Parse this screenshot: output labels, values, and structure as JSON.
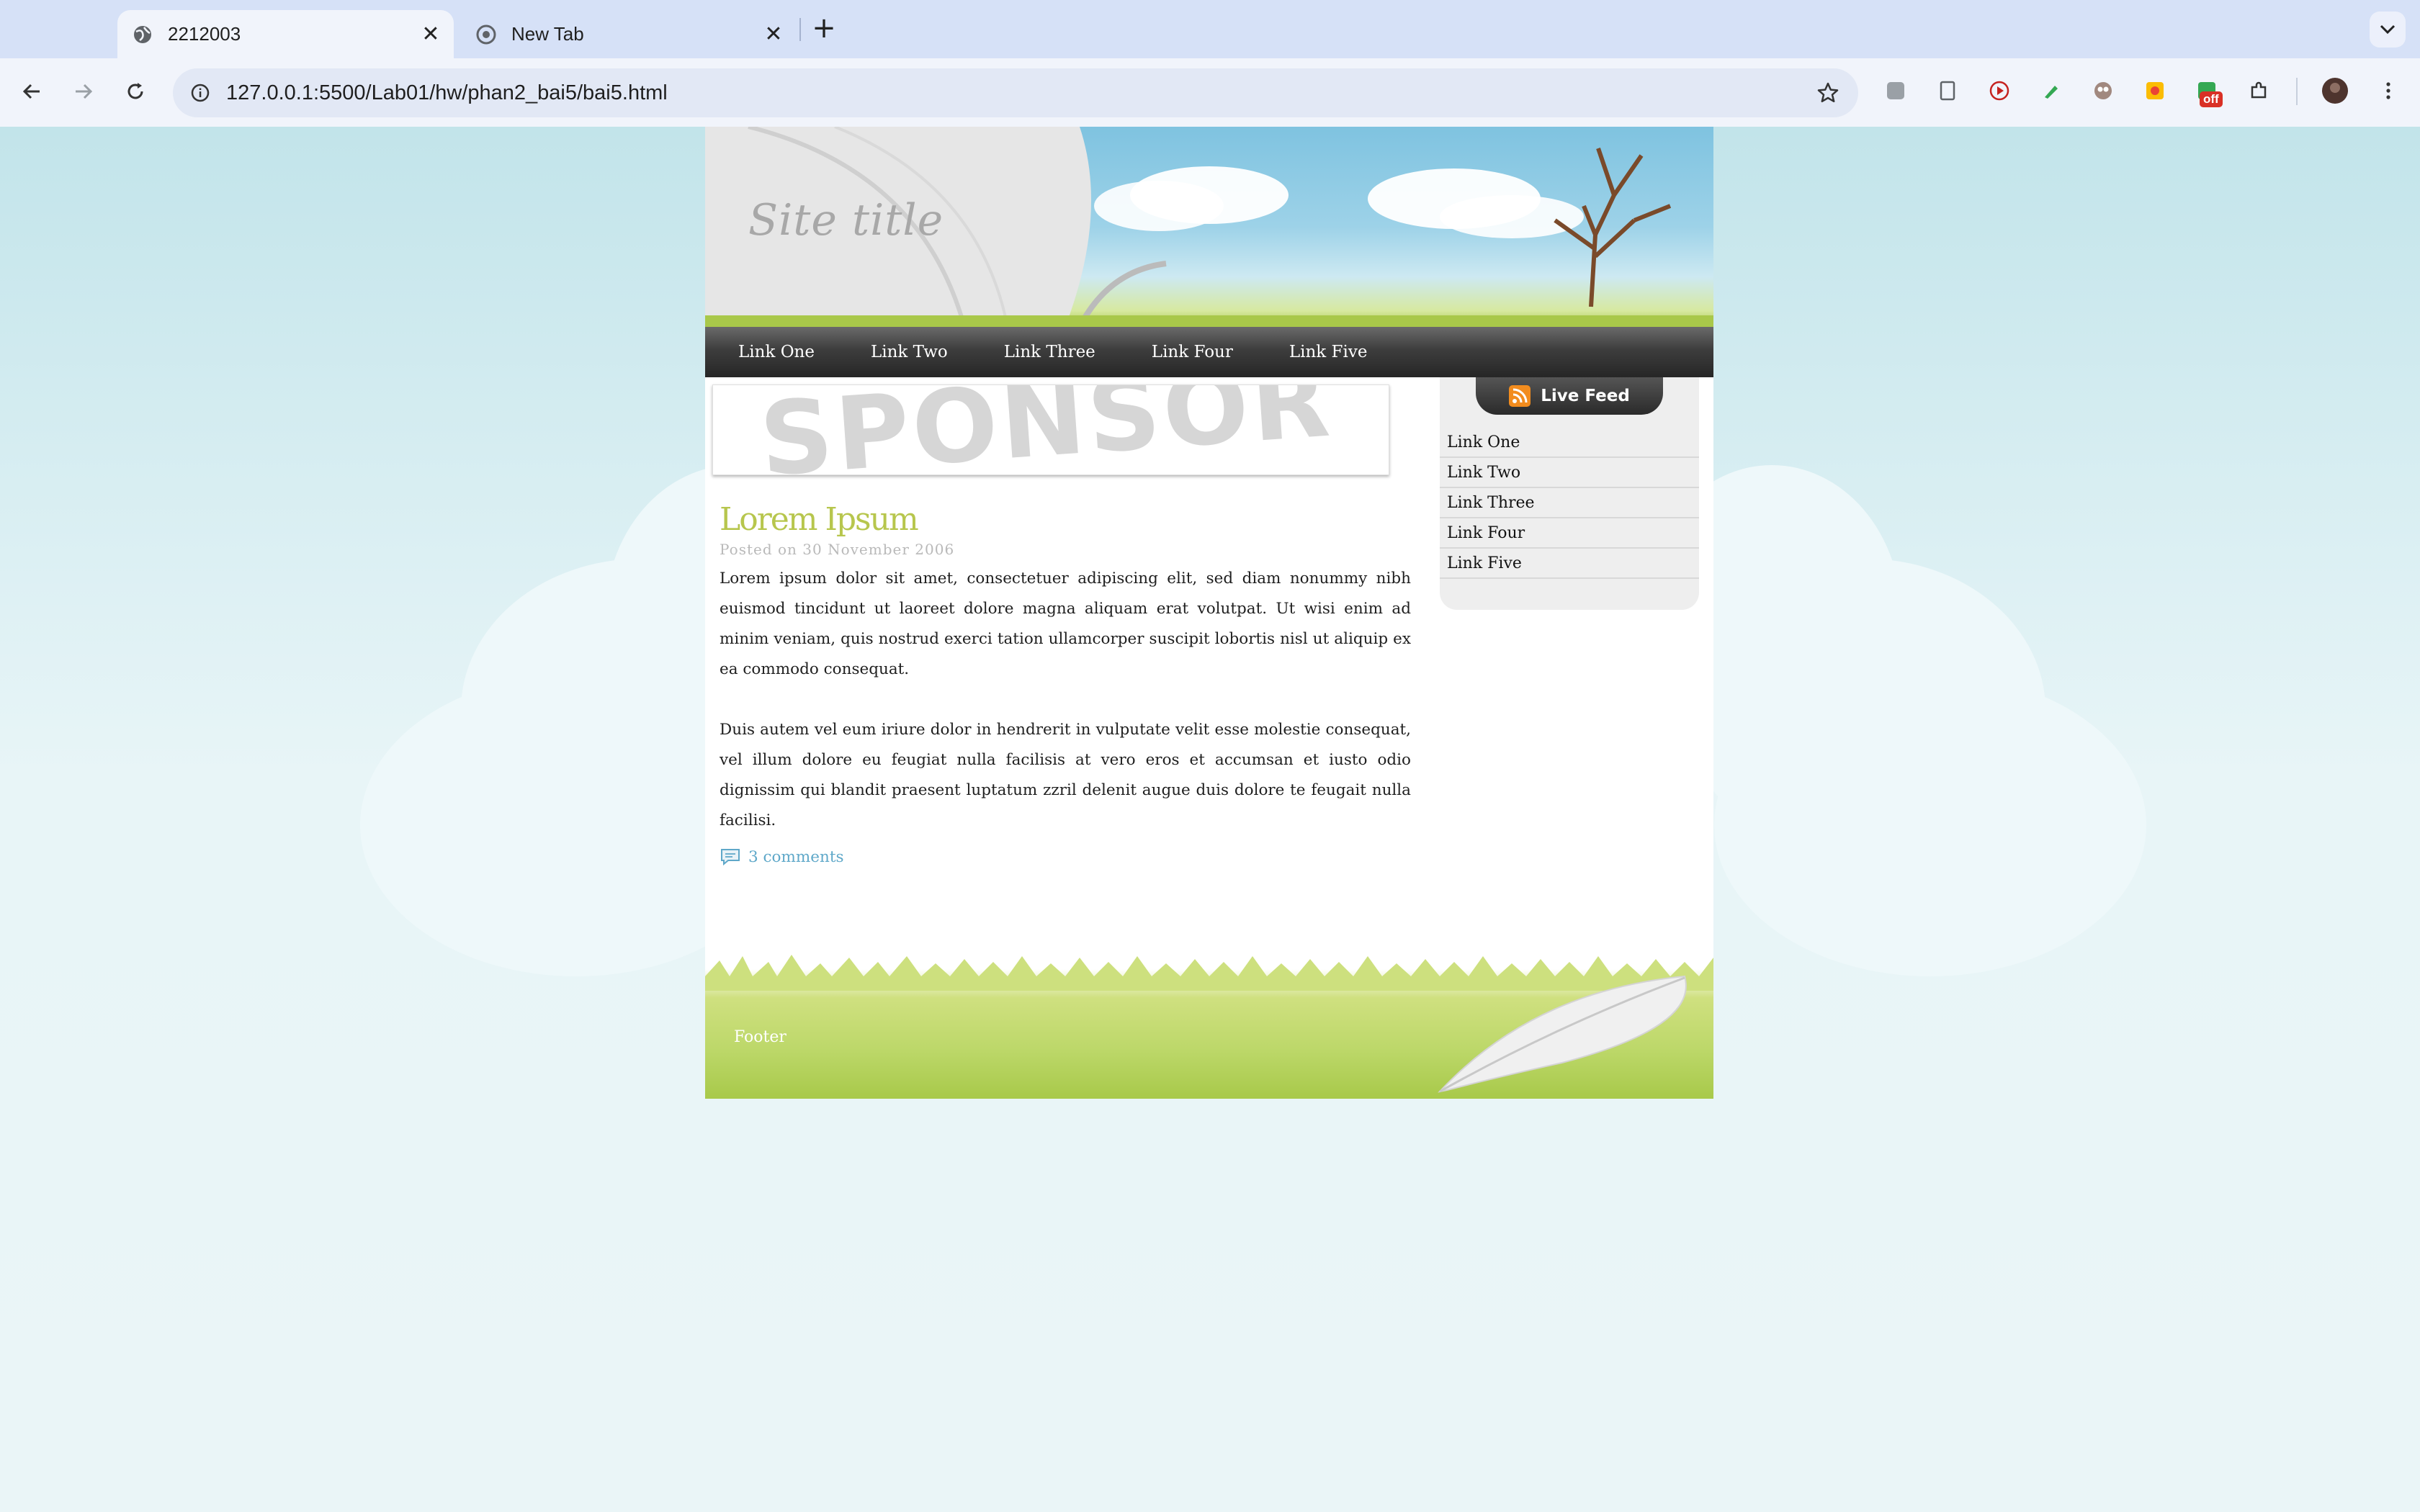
{
  "browser": {
    "tabs": [
      {
        "title": "2212003",
        "active": true
      },
      {
        "title": "New Tab",
        "active": false
      }
    ],
    "close_glyph": "✕",
    "new_tab_glyph": "+",
    "address": "127.0.0.1:5500/Lab01/hw/phan2_bai5/bai5.html",
    "extension_badge": "off"
  },
  "site": {
    "title": "Site title",
    "nav": [
      "Link One",
      "Link Two",
      "Link Three",
      "Link Four",
      "Link Five"
    ],
    "sponsor_text": "SPONSOR",
    "post": {
      "title": "Lorem Ipsum",
      "meta": "Posted on 30 November 2006",
      "paragraphs": [
        "Lorem ipsum dolor sit amet, consectetuer adipiscing elit, sed diam nonummy nibh euismod tincidunt ut laoreet dolore magna aliquam erat volutpat. Ut wisi enim ad minim veniam, quis nostrud exerci tation ullamcorper suscipit lobortis nisl ut aliquip ex ea commodo consequat.",
        "Duis autem vel eum iriure dolor in hendrerit in vulputate velit esse molestie consequat, vel illum dolore eu feugiat nulla facilisis at vero eros et accumsan et iusto odio dignissim qui blandit praesent luptatum zzril delenit augue duis dolore te feugait nulla facilisi."
      ],
      "comments": "3 comments"
    },
    "sidebar": {
      "heading": "Live Feed",
      "links": [
        "Link One",
        "Link Two",
        "Link Three",
        "Link Four",
        "Link Five"
      ]
    },
    "footer": "Footer"
  },
  "colors": {
    "post_title": "#b7c64d",
    "comments_link": "#5fa8c9",
    "nav_bg": "#333333",
    "footer_green": "#bdd86a"
  }
}
